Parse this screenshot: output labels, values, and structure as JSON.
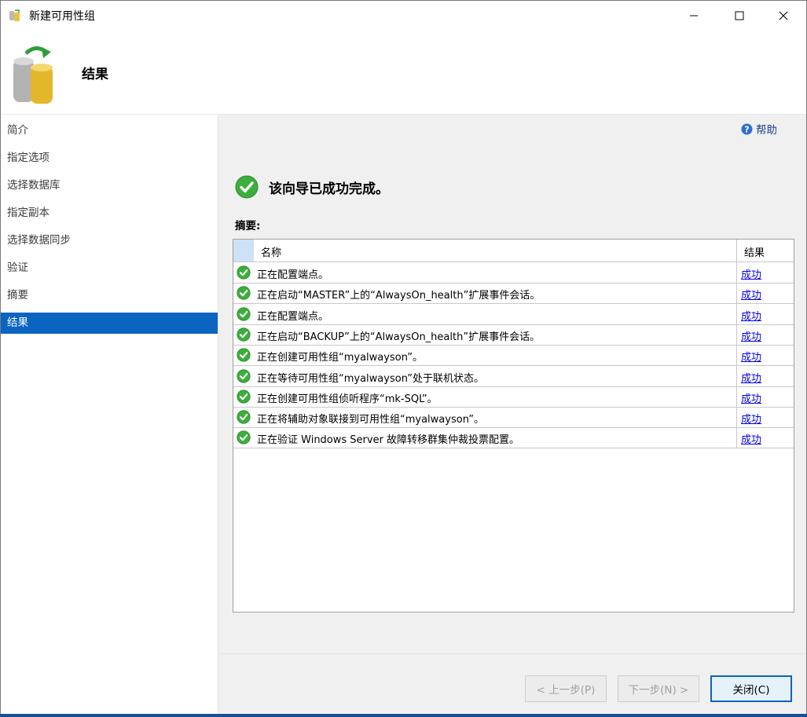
{
  "window": {
    "title": "新建可用性组"
  },
  "header": {
    "title": "结果"
  },
  "nav": {
    "items": [
      {
        "label": "简介"
      },
      {
        "label": "指定选项"
      },
      {
        "label": "选择数据库"
      },
      {
        "label": "指定副本"
      },
      {
        "label": "选择数据同步"
      },
      {
        "label": "验证"
      },
      {
        "label": "摘要"
      },
      {
        "label": "结果",
        "selected": true
      }
    ]
  },
  "content": {
    "help_label": "帮助",
    "status_message": "该向导已成功完成。",
    "summary_label": "摘要:",
    "columns": {
      "name": "名称",
      "result": "结果"
    },
    "rows": [
      {
        "name": "正在配置端点。",
        "result": "成功"
      },
      {
        "name": "正在启动“MASTER”上的“AlwaysOn_health”扩展事件会话。",
        "result": "成功"
      },
      {
        "name": "正在配置端点。",
        "result": "成功"
      },
      {
        "name": "正在启动“BACKUP”上的“AlwaysOn_health”扩展事件会话。",
        "result": "成功"
      },
      {
        "name": "正在创建可用性组“myalwayson”。",
        "result": "成功"
      },
      {
        "name": "正在等待可用性组“myalwayson”处于联机状态。",
        "result": "成功"
      },
      {
        "name": "正在创建可用性组侦听程序“mk-SQL”。",
        "result": "成功"
      },
      {
        "name": "正在将辅助对象联接到可用性组“myalwayson”。",
        "result": "成功"
      },
      {
        "name": "正在验证 Windows Server 故障转移群集仲裁投票配置。",
        "result": "成功"
      }
    ]
  },
  "footer": {
    "back_label": "< 上一步(P)",
    "next_label": "下一步(N) >",
    "close_label": "关闭(C)"
  },
  "icons": {
    "app": "database-wizard-icon",
    "header": "database-refresh-icon",
    "help": "help-circle-icon",
    "status": "success-check-icon",
    "row_status": "success-check-icon"
  },
  "colors": {
    "accent": "#0a64c0",
    "success": "#3cae3c",
    "link": "#0000ee",
    "panel": "#f0f0f0"
  }
}
